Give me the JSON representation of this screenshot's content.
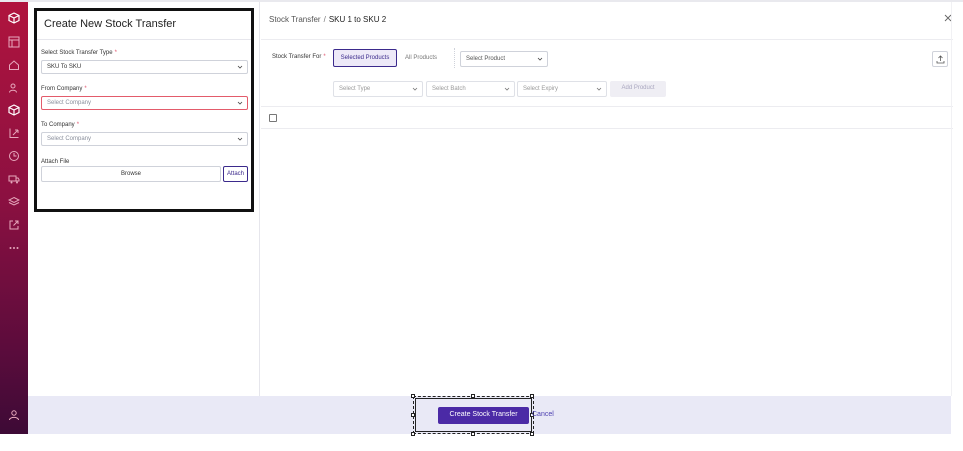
{
  "form": {
    "title": "Create New Stock Transfer",
    "type_label": "Select Stock Transfer Type",
    "type_value": "SKU To SKU",
    "from_label": "From Company",
    "from_placeholder": "Select Company",
    "to_label": "To Company",
    "to_placeholder": "Select Company",
    "attach_label": "Attach File",
    "browse_label": "Browse",
    "attach_button": "Attach",
    "required_mark": "*"
  },
  "header": {
    "breadcrumb_parent": "Stock Transfer",
    "breadcrumb_sep": "/",
    "breadcrumb_current": "SKU 1 to SKU 2"
  },
  "filters": {
    "transfer_for_label": "Stock Transfer For",
    "selected_products": "Selected Products",
    "all_products": "All Products",
    "select_product": "Select Product",
    "select_type": "Select Type",
    "select_batch": "Select Batch",
    "select_expiry": "Select Expiry",
    "add_product": "Add Product"
  },
  "footer": {
    "create_button": "Create Stock Transfer",
    "cancel_link": "Cancel"
  },
  "colors": {
    "primary": "#4b2aa6",
    "sidebar_top": "#b0143e",
    "sidebar_bottom": "#3d0a36",
    "error_border": "#e35b6b",
    "footer_bg": "#e9e9f6"
  }
}
